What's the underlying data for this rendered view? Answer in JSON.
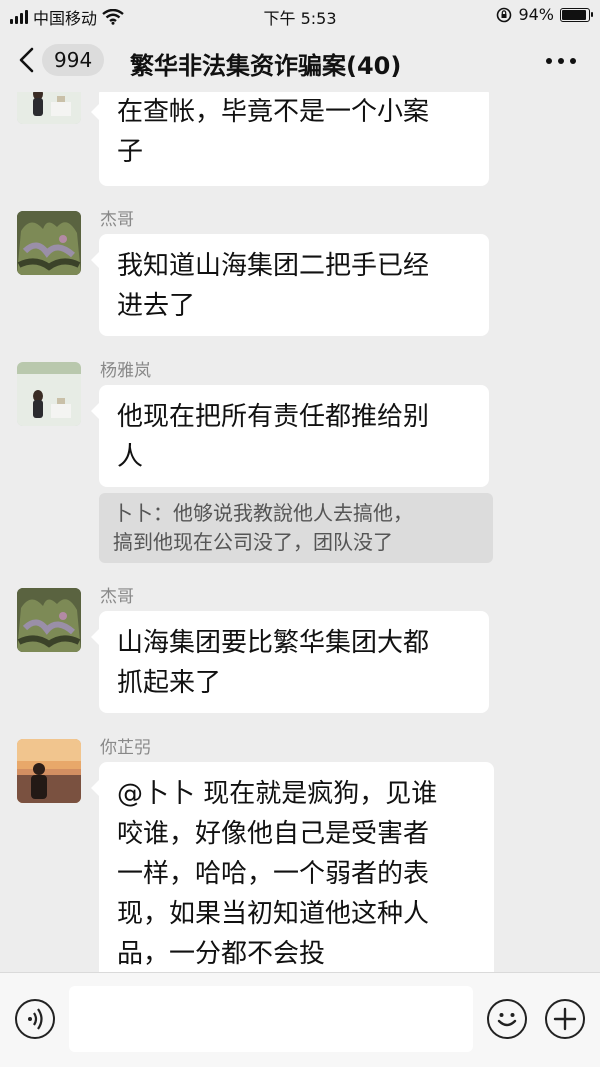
{
  "status_bar": {
    "carrier": "中国移动",
    "time": "下午 5:53",
    "battery_text": "94%",
    "battery_level": 0.94
  },
  "nav": {
    "back_icon": "chevron-left-icon",
    "unread_count": "994",
    "title": "繁华非法集资诈骗案(40)",
    "more_icon": "more-dots-icon"
  },
  "messages": [
    {
      "sender": "",
      "avatar": "photo-woman-sitting",
      "lines": [
        "在查帐，毕竟不是一个小案",
        "子"
      ]
    },
    {
      "sender": "杰哥",
      "avatar": "photo-plants",
      "lines": [
        "我知道山海集团二把手已经",
        "进去了"
      ]
    },
    {
      "sender": "杨雅岚",
      "avatar": "photo-woman-sitting",
      "lines": [
        "他现在把所有责任都推给别",
        "人"
      ],
      "quote_lines": [
        "卜卜：他够说我教說他人去搞他，",
        "搞到他现在公司没了，团队没了"
      ]
    },
    {
      "sender": "杰哥",
      "avatar": "photo-plants",
      "lines": [
        "山海集团要比繁华集团大都",
        "抓起来了"
      ]
    },
    {
      "sender": "你芷弜",
      "avatar": "photo-man-sunset",
      "lines": [
        "@卜卜 现在就是疯狗，见谁",
        "咬谁，好像他自己是受害者",
        "一样，哈哈，一个弱者的表",
        "现，如果当初知道他这种人",
        "品，一分都不会投"
      ]
    }
  ],
  "input_bar": {
    "voice_icon": "voice-icon",
    "input_value": "",
    "emoji_icon": "emoji-icon",
    "plus_icon": "plus-icon"
  }
}
